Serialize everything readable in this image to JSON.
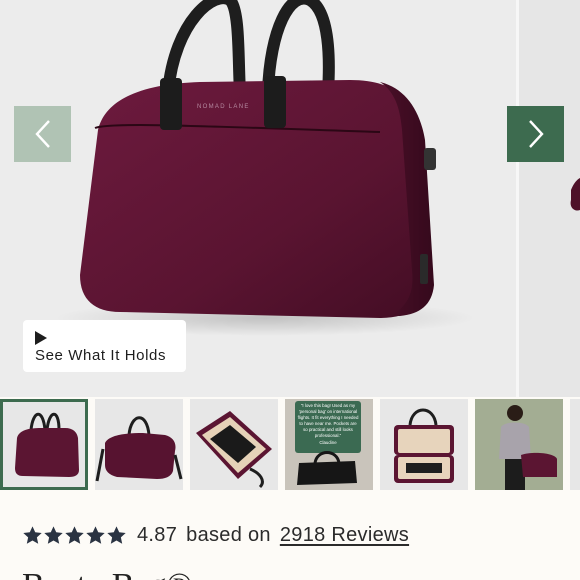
{
  "gallery": {
    "brand_mark": "NOMAD LANE",
    "video_label": "See What It Holds",
    "prev_icon": "chevron-left-icon",
    "next_icon": "chevron-right-icon",
    "colors": {
      "prev_arrow": "#b0c3b4",
      "next_arrow": "#3d6b4f",
      "bag": "#5e1634"
    }
  },
  "thumbnails": {
    "selected_index": 0,
    "quote_lines": [
      "\"I love this bag! Used as my",
      "'personal bag' on international",
      "flights. It fit everything I needed",
      "to have near me. Pockets are",
      "so practical and still looks",
      "professional.\"",
      "Claudine"
    ]
  },
  "rating": {
    "stars": 5,
    "value": "4.87",
    "text": "based on",
    "reviews_link": "2918 Reviews",
    "star_color": "#2a3342"
  },
  "product": {
    "title": "Bento Bag®"
  }
}
